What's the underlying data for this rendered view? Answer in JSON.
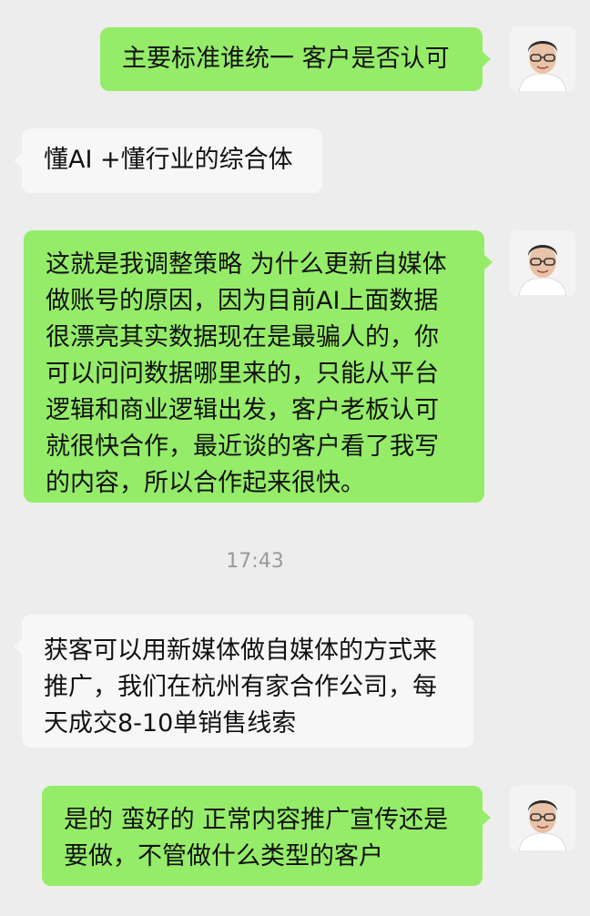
{
  "messages": [
    {
      "sender": "me",
      "text": "主要标准谁统一 客户是否认可"
    },
    {
      "sender": "other",
      "text": "懂AI +懂行业的综合体"
    },
    {
      "sender": "me",
      "text": "这就是我调整策略 为什么更新自媒体\n做账号的原因，因为目前AI上面数据\n很漂亮其实数据现在是最骗人的，你\n可以问问数据哪里来的，只能从平台\n逻辑和商业逻辑出发，客户老板认可\n就很快合作，最近谈的客户看了我写\n的内容，所以合作起来很快。"
    },
    {
      "sender": "other",
      "text": "获客可以用新媒体做自媒体的方式来\n推广，我们在杭州有家合作公司，每\n天成交8-10单销售线索"
    },
    {
      "sender": "me",
      "text": "是的 蛮好的 正常内容推广宣传还是\n要做，不管做什么类型的客户"
    }
  ],
  "timestamp": "17:43",
  "colors": {
    "background": "#ededed",
    "outgoing_bubble": "#95ec69",
    "incoming_bubble": "#f7f7f7",
    "timestamp_text": "#9a9a9a"
  }
}
